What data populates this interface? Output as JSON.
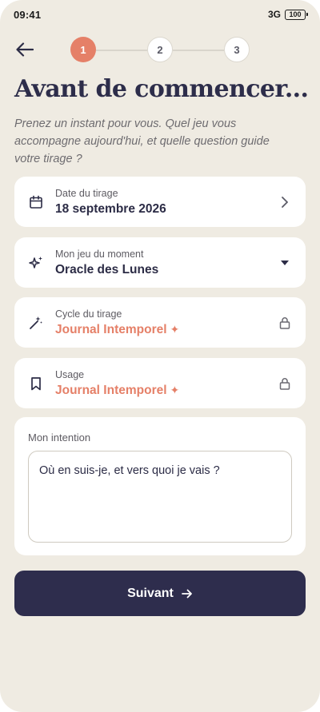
{
  "status_bar": {
    "time": "09:41",
    "network": "3G",
    "battery": "100"
  },
  "stepper": {
    "steps": [
      "1",
      "2",
      "3"
    ],
    "current_step": 1
  },
  "header": {
    "title": "Avant de commencer...",
    "subtitle": "Prenez un instant pour vous. Quel jeu vous accompagne aujourd'hui, et quelle question guide votre tirage ?"
  },
  "fields": {
    "date": {
      "label": "Date du tirage",
      "value": "18 septembre 2026"
    },
    "deck": {
      "label": "Mon jeu du moment",
      "value": "Oracle des Lunes"
    },
    "cycle": {
      "label": "Cycle du tirage",
      "value": "Journal Intemporel",
      "mark": "✦"
    },
    "usage": {
      "label": "Usage",
      "value": "Journal Intemporel",
      "mark": "✦"
    }
  },
  "intention": {
    "label": "Mon intention",
    "value": "Où en suis-je, et vers quoi je vais ?"
  },
  "actions": {
    "next_label": "Suivant"
  },
  "colors": {
    "accent": "#e58068",
    "primary": "#2e2d4d",
    "background": "#efebe2",
    "card": "#ffffff"
  }
}
